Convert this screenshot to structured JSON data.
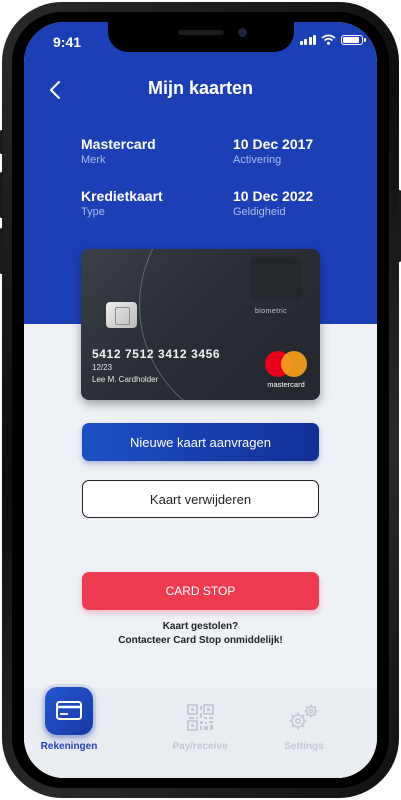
{
  "status_bar": {
    "time": "9:41"
  },
  "header": {
    "title": "Mijn kaarten",
    "back_icon": "chevron-left-icon"
  },
  "card_info": [
    {
      "value": "Mastercard",
      "label": "Merk"
    },
    {
      "value": "10 Dec 2017",
      "label": "Activering"
    },
    {
      "value": "Kredietkaart",
      "label": "Type"
    },
    {
      "value": "10 Dec 2022",
      "label": "Geldigheid"
    }
  ],
  "card": {
    "biometric_label": "biometric",
    "number": "5412 7512 3412 3456",
    "valid_thru": "12/23",
    "holder": "Lee M. Cardholder",
    "network": "mastercard"
  },
  "actions": {
    "request_new": "Nieuwe kaart aanvragen",
    "delete": "Kaart verwijderen",
    "card_stop": "CARD STOP"
  },
  "stolen": {
    "line1": "Kaart gestolen?",
    "line2": "Contacteer Card Stop onmiddelijk!"
  },
  "tabs": [
    {
      "label": "Rekeningen",
      "icon": "card-icon",
      "active": true
    },
    {
      "label": "Pay/receive",
      "icon": "qr-code-icon",
      "active": false
    },
    {
      "label": "Settings",
      "icon": "gears-icon",
      "active": false
    }
  ],
  "colors": {
    "header_blue": "#1d3fb6",
    "primary_button": "#1d4fc4",
    "card_stop": "#ee3b52",
    "active_tab_text": "#1d3fb6",
    "inactive_tab_text": "#c2c7d1"
  }
}
